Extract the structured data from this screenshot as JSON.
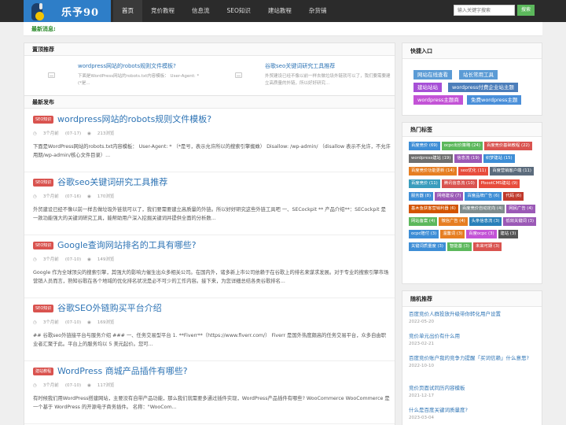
{
  "header": {
    "logo_text": "乐予90",
    "nav": [
      "首页",
      "竞价教程",
      "信息流",
      "SEO知识",
      "建站教程",
      "杂货铺"
    ],
    "search_placeholder": "输入关键字搜索",
    "search_button": "搜索"
  },
  "newsbar": {
    "label": "最新消息:"
  },
  "sticky": {
    "title": "置顶推荐",
    "items": [
      {
        "title": "wordpress网站的robots规则文件模板?",
        "desc": "下面是WordPress网站的robots.txt内容模板： User-Agent: * (*是..."
      },
      {
        "title": "谷歌seo关键词研究工具推荐",
        "desc": "外贸建设已经不像以前一样去做垃圾外链就可以了，我们要需要建立高质量的外链，所以好好研究..."
      }
    ]
  },
  "latest": {
    "title": "最新发布",
    "articles": [
      {
        "badge": "SEO知识",
        "title": "wordpress网站的robots规则文件模板?",
        "time": "3个月前",
        "date": "(07-17)",
        "views": "213浏览",
        "desc": "下面是WordPress网站的robots.txt内容模板： User-Agent: * （*是号，表示允许所以的搜索引擎蜘蛛） Disallow: /wp-admin/ （disallow 表示不允许，不允许用期/wp-admin/核心文件目录）..."
      },
      {
        "badge": "SEO知识",
        "title": "谷歌seo关键词研究工具推荐",
        "time": "3个月前",
        "date": "(07-16)",
        "views": "170浏览",
        "desc": "外贸建设已经不像以前一样去做垃圾外链就可以了，我们要需要建立高质量的外链。所以好好研究这些外链工具吧 一、SECockpit ** 产品介绍**：SECockpit 是一款功能强大的关键词研究工具，能帮助用户深入挖掘关键词并提供全面的分析数..."
      },
      {
        "badge": "SEO知识",
        "title": "Google查询网站排名的工具有哪些?",
        "time": "3个月前",
        "date": "(07-10)",
        "views": "149浏览",
        "desc": "Google 作为全球顶尖的搜索引擎，其强大的影响力催生出众多相关公司。在国内外，诸多新上市公司依赖于在谷歌上的排名来谋求发展。对于专业的搜索引擎市场营销人员而言，熟知谷歌在各个地域的优化排名状况是必不可少的工作内容。接下来，为您详细总结各类谷歌排名..."
      },
      {
        "badge": "SEO知识",
        "title": "谷歌SEO外链购买平台介绍",
        "time": "3个月前",
        "date": "(07-10)",
        "views": "169浏览",
        "desc": "## 谷歌seo外链接平台与服务介绍 ### 一、任务交易型平台 1. **Fiverr**（https://www.fiverr.com/） Fiverr 是国外热度颇高的任务交易平台，众多自由职业者汇聚于此。平台上的服务均以 5 美元起价。您可..."
      },
      {
        "badge": "建站教程",
        "title": "WordPress 商城产品插件有哪些?",
        "time": "3个月前",
        "date": "(07-10)",
        "views": "117浏览",
        "desc": "有时候我们用WordPress搭建网站，主要没有自带产品功能，那么我们就需要多通过插件实现，WordPress产品插件有哪些? WooCommerce WooCommerce 是一个基于 WordPress 的开源电子商务插件。 名称：\"WooCom..."
      }
    ]
  },
  "quick": {
    "title": "快捷入口",
    "links": [
      {
        "label": "网站在线查看",
        "color": "#5b9bd5"
      },
      {
        "label": "站长常用工具",
        "color": "#5b9bd5"
      },
      {
        "label": "建站站站",
        "color": "#a64fd6"
      },
      {
        "label": "wordpress付费企业站主题",
        "color": "#4b7dba"
      },
      {
        "label": "wordpress主题商",
        "color": "#c353d6"
      },
      {
        "label": "免费wordpress主题",
        "color": "#4a8fd9"
      }
    ]
  },
  "tags": {
    "title": "热门标签",
    "items": [
      {
        "label": "百度竞价 (69)",
        "color": "#3e8ed6"
      },
      {
        "label": "ocpc出价策略 (24)",
        "color": "#5cb85c"
      },
      {
        "label": "百度竞价基础教程 (22)",
        "color": "#d9534f"
      },
      {
        "label": "wordpress建站 (19)",
        "color": "#6f6f6f"
      },
      {
        "label": "信息流 (19)",
        "color": "#9b59b6"
      },
      {
        "label": "织梦建站 (15)",
        "color": "#3e8ed6"
      },
      {
        "label": "百度竞价功能更新 (14)",
        "color": "#e67e22"
      },
      {
        "label": "seo优化 (11)",
        "color": "#e74c3c"
      },
      {
        "label": "百度营销客户端 (11)",
        "color": "#5b6b7c"
      },
      {
        "label": "百度竞价 (11)",
        "color": "#3a9dbd"
      },
      {
        "label": "腾讯信息流 (10)",
        "color": "#d9534f"
      },
      {
        "label": "PbootCMS建站 (9)",
        "color": "#e74c3c"
      },
      {
        "label": "服务器 (8)",
        "color": "#3e8ed6"
      },
      {
        "label": "网络建设 (7)",
        "color": "#9b59b6"
      },
      {
        "label": "百度品牌广告 (6)",
        "color": "#3e8ed6"
      },
      {
        "label": "代码 (6)",
        "color": "#c0392b"
      },
      {
        "label": "基木鱼获客营销利器 (6)",
        "color": "#d35400"
      },
      {
        "label": "百度竞价自动定向 (4)",
        "color": "#7f8c8d"
      },
      {
        "label": "网民广告 (4)",
        "color": "#9b59b6"
      },
      {
        "label": "网站备案 (4)",
        "color": "#5cb85c"
      },
      {
        "label": "微信广告 (4)",
        "color": "#e67e22"
      },
      {
        "label": "头条信息流 (3)",
        "color": "#2980b9"
      },
      {
        "label": "低效关键词 (3)",
        "color": "#9b59b6"
      },
      {
        "label": "ocpc赔付 (3)",
        "color": "#3e8ed6"
      },
      {
        "label": "温馨词 (3)",
        "color": "#e67e22"
      },
      {
        "label": "百度ocpc (3)",
        "color": "#c353d6"
      },
      {
        "label": "建站 (3)",
        "color": "#555555"
      },
      {
        "label": "关键词质量度 (3)",
        "color": "#3e8ed6"
      },
      {
        "label": "智能基 (3)",
        "color": "#5cb85c"
      },
      {
        "label": "未来可期 (3)",
        "color": "#d9534f"
      }
    ]
  },
  "random": {
    "title": "随机推荐",
    "items": [
      {
        "title": "百度竞价人群投放升级带你转化用户设置",
        "date": "2022-05-20"
      },
      {
        "title": "竞价单元出价有什么用",
        "date": "2023-02-21"
      },
      {
        "title": "百度竞价账户我的竞争力提醒「买词信赖」什么意思?",
        "date": "2022-10-10"
      },
      {
        "title": "竞价页面试同历内容模板",
        "date": "2021-12-17"
      },
      {
        "title": "什么是百度关键词质量度?",
        "date": "2023-03-04"
      }
    ]
  }
}
